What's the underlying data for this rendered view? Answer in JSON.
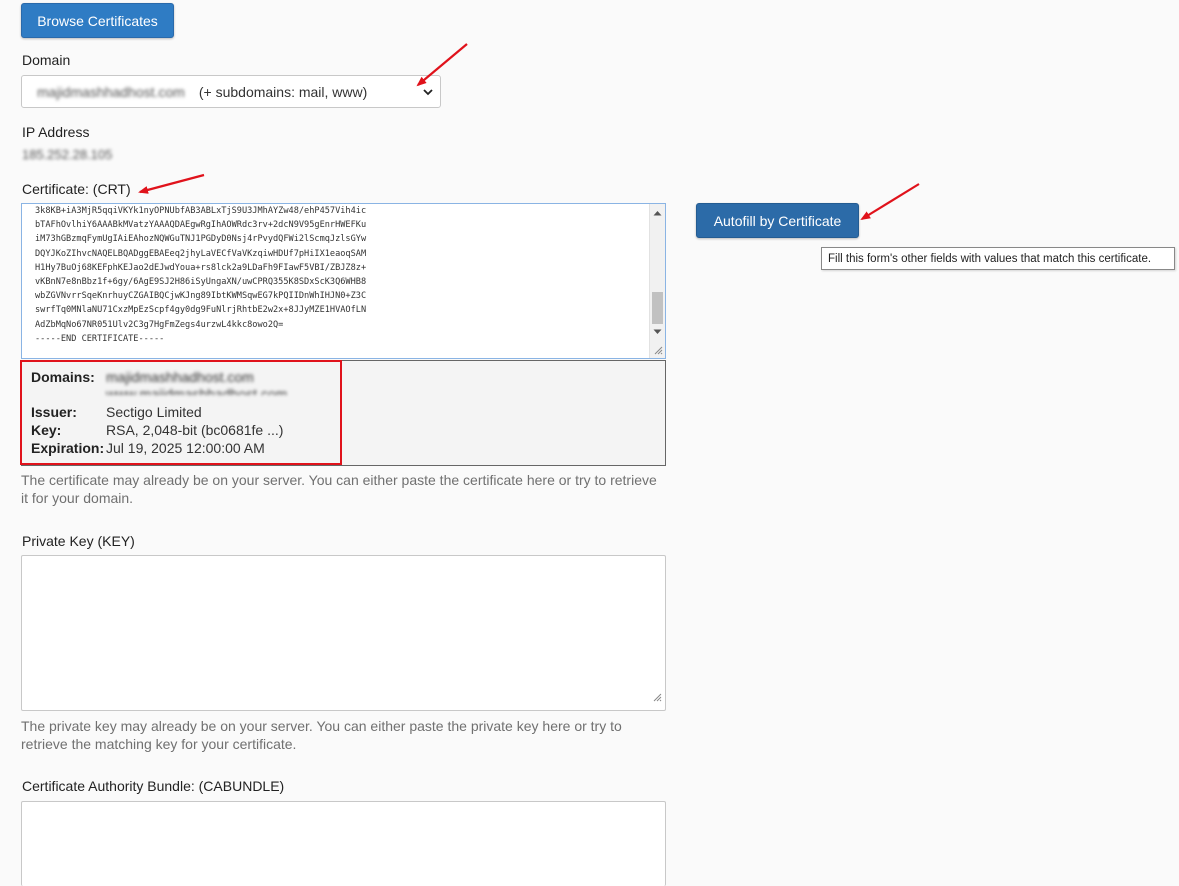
{
  "toolbar": {
    "browse_label": "Browse Certificates"
  },
  "domain": {
    "label": "Domain",
    "selected_domain": "majidmashhadhost.com",
    "subdomains_note": "(+ subdomains: mail, www)"
  },
  "ip": {
    "label": "IP Address",
    "value": "185.252.28.105"
  },
  "certificate": {
    "label": "Certificate: (CRT)",
    "lines": [
      "3k8KB+iA3MjR5qqiVKYk1nyOPNUbfAB3ABLxTjS9U3JMhAYZw48/ehP457Vih4ic",
      "bTAFhOvlhiY6AAABkMVatzYAAAQDAEgwRgIhAOWRdc3rv+2dcN9V95gEnrHWEFKu",
      "iM73hGBzmqFymUgIAiEAhozNQWGuTNJ1PGDyD0Nsj4rPvydQFWi2lScmqJzlsGYw",
      "DQYJKoZIhvcNAQELBQADggEBAEeq2jhyLaVECfVaVKzqiwHDUf7pHiIX1eaoqSAM",
      "H1Hy7BuOj68KEFphKEJao2dEJwdYoua+rs8lck2a9LDaFh9FIawF5VBI/ZBJZ8z+",
      "vKBnN7e8nBbz1f+6gy/6AgE9SJ2H86iSyUngaXN/uwCPRQ355K8SDxScK3Q6WHB8",
      "wbZGVNvrrSqeKnrhuyCZGAIBQCjwKJng89IbtKWMSqwEG7kPQIIDnWhIHJN0+Z3C",
      "swrfTq0MNlaNU71CxzMpEzScpf4gy0dg9FuNlrjRhtbE2w2x+8JJyMZE1HVAOfLN",
      "AdZbMqNo67NR051Ulv2C3g7HgFmZegs4urzwL4kkc8owo2Q=",
      "-----END CERTIFICATE-----"
    ],
    "info": {
      "domains_label": "Domains:",
      "domains": [
        "majidmashhadhost.com",
        "www.majidmashhadhost.com"
      ],
      "issuer_label": "Issuer:",
      "issuer": "Sectigo Limited",
      "key_label": "Key:",
      "key": "RSA, 2,048-bit (bc0681fe ...)",
      "expiration_label": "Expiration:",
      "expiration": "Jul 19, 2025 12:00:00 AM"
    },
    "help": "The certificate may already be on your server. You can either paste the certificate here or try to retrieve it for your domain."
  },
  "autofill": {
    "button_label": "Autofill by Certificate",
    "tooltip": "Fill this form's other fields with values that match this certificate."
  },
  "private_key": {
    "label": "Private Key (KEY)",
    "value": "",
    "help": "The private key may already be on your server. You can either paste the private key here or try to retrieve the matching key for your certificate."
  },
  "cabundle": {
    "label": "Certificate Authority Bundle: (CABUNDLE)",
    "value": ""
  },
  "colors": {
    "primary": "#2f7cc4",
    "annotation_red": "#e0121b",
    "focus_border": "#8ab4e4",
    "help_text": "#707070"
  }
}
